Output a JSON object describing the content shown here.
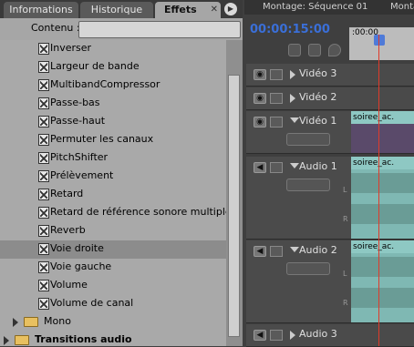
{
  "left_panel": {
    "tabs": [
      {
        "label": "Informations",
        "active": false
      },
      {
        "label": "Historique",
        "active": false
      },
      {
        "label": "Effets",
        "active": true
      }
    ],
    "search_label": "Contenu :",
    "search_value": "",
    "effects": [
      "Inverser",
      "Largeur de bande",
      "MultibandCompressor",
      "Passe-bas",
      "Passe-haut",
      "Permuter les canaux",
      "PitchShifter",
      "Prélèvement",
      "Retard",
      "Retard de référence sonore multiple",
      "Reverb",
      "Voie droite",
      "Voie gauche",
      "Volume",
      "Volume de canal"
    ],
    "selected_effect": "Voie droite",
    "folders": [
      {
        "label": "Mono"
      },
      {
        "label": "Transitions audio"
      }
    ]
  },
  "right_panel": {
    "tabs": [
      "Montage: Séquence 01",
      "Monta"
    ],
    "timecode": "00:00:15:00",
    "ruler_label": ":00:00",
    "tracks": [
      {
        "name": "Vidéo 3",
        "type": "video"
      },
      {
        "name": "Vidéo 2",
        "type": "video"
      },
      {
        "name": "Vidéo 1",
        "type": "video",
        "clip": "soiree_ac."
      },
      {
        "name": "Audio 1",
        "type": "audio",
        "clip": "soiree_ac."
      },
      {
        "name": "Audio 2",
        "type": "audio",
        "clip": "soiree_ac."
      },
      {
        "name": "Audio 3",
        "type": "audio"
      }
    ],
    "channel_labels": {
      "left": "L",
      "right": "R"
    }
  },
  "colors": {
    "timecode": "#3a6fd8",
    "playhead": "#e03a2a",
    "clip": "#7fb8b3",
    "selected_row": "#8c8c8c",
    "panel_bg": "#a9a9a9"
  }
}
